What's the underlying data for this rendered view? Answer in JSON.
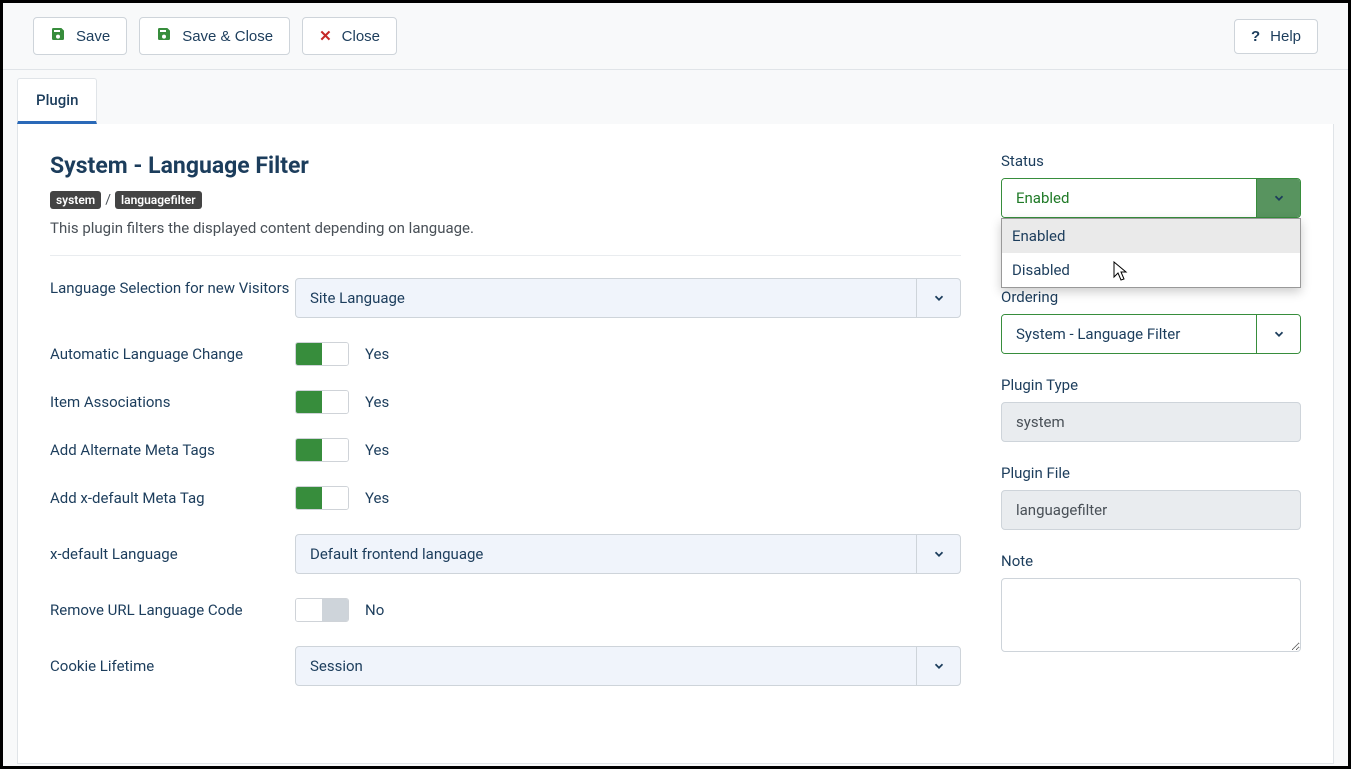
{
  "toolbar": {
    "save": "Save",
    "saveClose": "Save & Close",
    "close": "Close",
    "help": "Help"
  },
  "tabs": {
    "plugin": "Plugin"
  },
  "header": {
    "title": "System - Language Filter",
    "badge1": "system",
    "badge2": "languagefilter",
    "description": "This plugin filters the displayed content depending on language."
  },
  "fields": {
    "langSelection": {
      "label": "Language Selection for new Visitors",
      "value": "Site Language"
    },
    "autoLangChange": {
      "label": "Automatic Language Change",
      "value": "Yes"
    },
    "itemAssoc": {
      "label": "Item Associations",
      "value": "Yes"
    },
    "altMeta": {
      "label": "Add Alternate Meta Tags",
      "value": "Yes"
    },
    "xdefaultMeta": {
      "label": "Add x-default Meta Tag",
      "value": "Yes"
    },
    "xdefaultLang": {
      "label": "x-default Language",
      "value": "Default frontend language"
    },
    "removeUrl": {
      "label": "Remove URL Language Code",
      "value": "No"
    },
    "cookie": {
      "label": "Cookie Lifetime",
      "value": "Session"
    }
  },
  "sidebar": {
    "status": {
      "label": "Status",
      "value": "Enabled",
      "options": {
        "o1": "Enabled",
        "o2": "Disabled"
      }
    },
    "ordering": {
      "label": "Ordering",
      "value": "System - Language Filter"
    },
    "pluginType": {
      "label": "Plugin Type",
      "value": "system"
    },
    "pluginFile": {
      "label": "Plugin File",
      "value": "languagefilter"
    },
    "note": {
      "label": "Note",
      "value": ""
    }
  }
}
